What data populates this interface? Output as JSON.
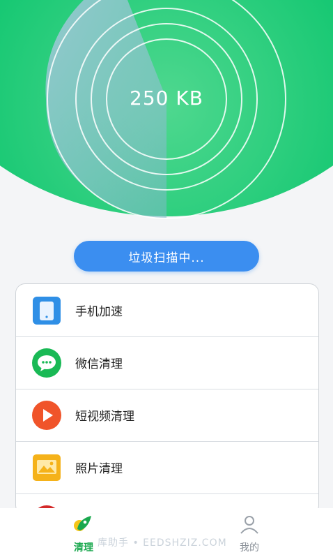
{
  "scanner": {
    "size_text": "250 KB",
    "scan_button_label": "垃圾扫描中..."
  },
  "features": [
    {
      "label": "手机加速",
      "icon": "phone-boost-icon",
      "color": "#2f8fe6"
    },
    {
      "label": "微信清理",
      "icon": "wechat-icon",
      "color": "#19b955"
    },
    {
      "label": "短视频清理",
      "icon": "play-video-icon",
      "color": "#f0542a"
    },
    {
      "label": "照片清理",
      "icon": "photo-icon",
      "color": "#f5b21a"
    }
  ],
  "tabbar": {
    "tabs": [
      {
        "label": "清理",
        "active": true,
        "icon": "rocket-icon"
      },
      {
        "label": "我的",
        "active": false,
        "icon": "user-icon"
      }
    ]
  },
  "watermark": "库助手 • EEDSHZIZ.COM",
  "colors": {
    "accent_green": "#10bf63",
    "button_blue": "#3b8ef0"
  }
}
